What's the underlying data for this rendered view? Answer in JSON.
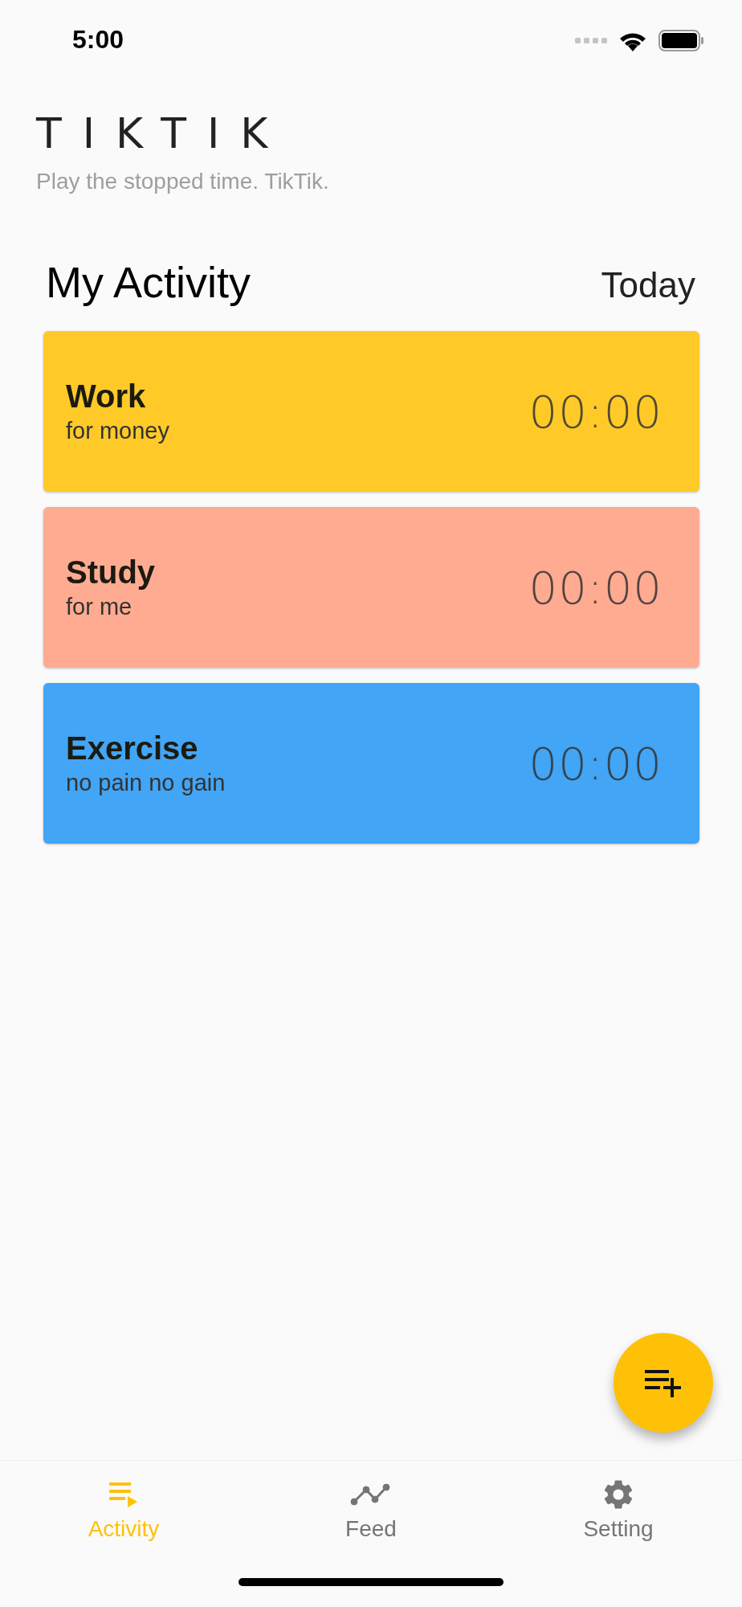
{
  "status_bar": {
    "time": "5:00"
  },
  "app": {
    "logo": "TIKTIK",
    "tagline": "Play the stopped time. TikTik."
  },
  "header": {
    "title": "My Activity",
    "period": "Today"
  },
  "activities": [
    {
      "name": "Work",
      "note": "for money",
      "time": "00:00",
      "color": "#ffca28"
    },
    {
      "name": "Study",
      "note": "for me",
      "time": "00:00",
      "color": "#ffab91"
    },
    {
      "name": "Exercise",
      "note": "no pain no gain",
      "time": "00:00",
      "color": "#42a5f5"
    }
  ],
  "nav": [
    {
      "label": "Activity",
      "kind": "playlist",
      "selected": true
    },
    {
      "label": "Feed",
      "kind": "chart",
      "selected": false
    },
    {
      "label": "Setting",
      "kind": "gear",
      "selected": false
    }
  ]
}
